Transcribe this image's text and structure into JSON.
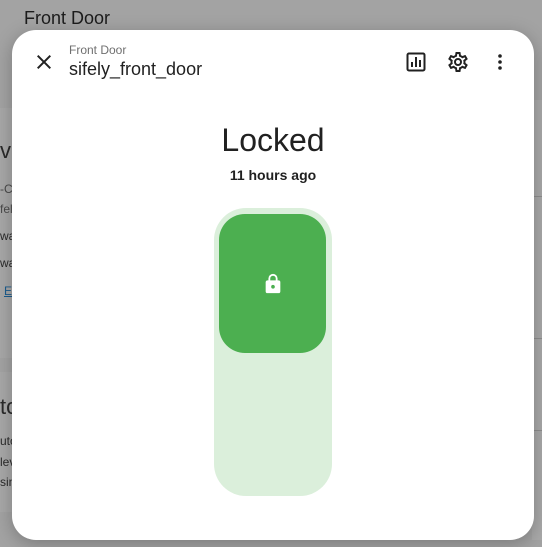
{
  "background": {
    "page_title": "Front Door",
    "fragments": [
      "vi",
      "-C",
      "fel",
      "wa",
      "wa",
      "E",
      "to",
      "uto",
      "lev",
      "sin"
    ]
  },
  "dialog": {
    "breadcrumb": "Front Door",
    "entity_name": "sifely_front_door",
    "state": "Locked",
    "last_changed": "11 hours ago",
    "lock_state": "locked",
    "icons": {
      "close": "close-icon",
      "history": "history-chart-icon",
      "settings": "gear-icon",
      "more": "more-vertical-icon",
      "lock": "lock-icon"
    }
  },
  "colors": {
    "accent_green": "#4caf50",
    "track_green_light": "#dbefdb"
  }
}
